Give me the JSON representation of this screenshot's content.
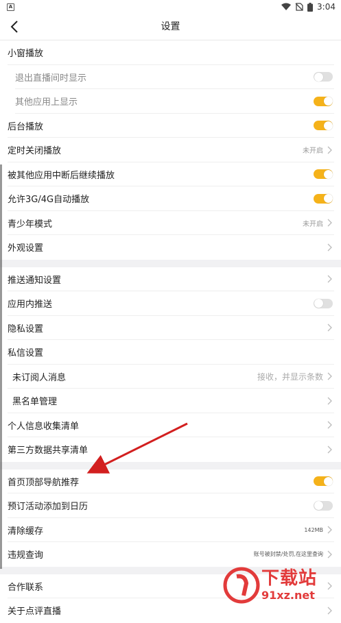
{
  "status": {
    "time": "3:04",
    "app_badge": "A"
  },
  "header": {
    "title": "设置"
  },
  "section1": [
    {
      "label": "小窗播放",
      "kind": "header"
    },
    {
      "label": "退出直播间时显示",
      "kind": "sub",
      "toggle": "off"
    },
    {
      "label": "其他应用上显示",
      "kind": "sub",
      "toggle": "on"
    },
    {
      "label": "后台播放",
      "toggle": "on"
    },
    {
      "label": "定时关闭播放",
      "value": "未开启",
      "chevron": true
    },
    {
      "label": "被其他应用中断后继续播放",
      "toggle": "on"
    },
    {
      "label": "允许3G/4G自动播放",
      "toggle": "on"
    },
    {
      "label": "青少年模式",
      "value": "未开启",
      "chevron": true
    },
    {
      "label": "外观设置",
      "chevron": true
    }
  ],
  "section2": [
    {
      "label": "推送通知设置",
      "chevron": true
    },
    {
      "label": "应用内推送",
      "toggle": "off"
    },
    {
      "label": "隐私设置",
      "chevron": true
    },
    {
      "label": "私信设置",
      "kind": "header"
    },
    {
      "label": "未订阅人消息",
      "kind": "sub2",
      "value": "接收，并显示条数",
      "chevron": true
    },
    {
      "label": "黑名单管理",
      "kind": "sub2",
      "chevron": true
    },
    {
      "label": "个人信息收集清单",
      "chevron": true
    },
    {
      "label": "第三方数据共享清单",
      "chevron": true
    }
  ],
  "section3": [
    {
      "label": "首页顶部导航推荐",
      "toggle": "on"
    },
    {
      "label": "预订活动添加到日历",
      "toggle": "off"
    },
    {
      "label": "清除缓存",
      "value": "142MB",
      "chevron": true
    },
    {
      "label": "违规查询",
      "value": "账号被封禁/处罚,在这里查询",
      "chevron": true
    }
  ],
  "section4": [
    {
      "label": "合作联系",
      "chevron": true
    },
    {
      "label": "关于点评直播",
      "chevron": true
    }
  ],
  "watermark": {
    "big": "下载站",
    "small": "91xz.net"
  },
  "colors": {
    "accent": "#f5b21a",
    "arrow": "#d21f1f"
  }
}
